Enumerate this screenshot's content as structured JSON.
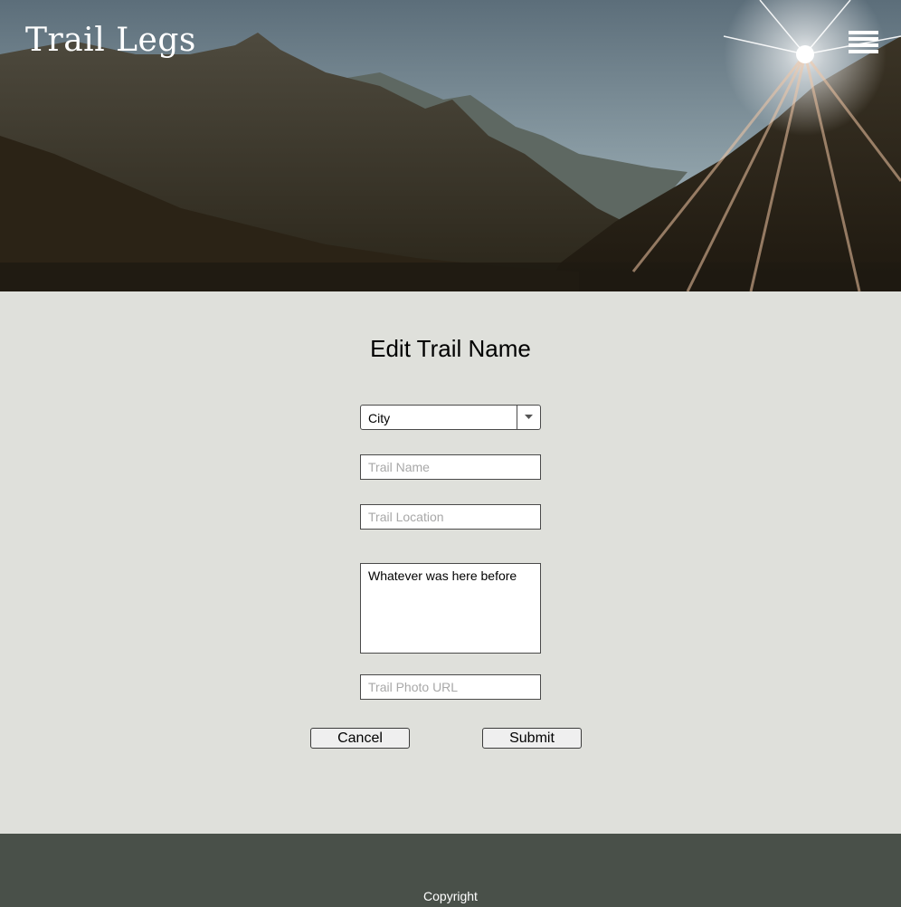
{
  "header": {
    "brand": "Trail Legs",
    "menu_icon": "hamburger-menu-icon"
  },
  "form": {
    "title": "Edit Trail Name",
    "city_select": {
      "selected": "City"
    },
    "trail_name": {
      "placeholder": "Trail Name",
      "value": ""
    },
    "trail_location": {
      "placeholder": "Trail Location",
      "value": ""
    },
    "description": {
      "value": "Whatever was here before"
    },
    "trail_photo_url": {
      "placeholder": "Trail Photo URL",
      "value": ""
    },
    "cancel_label": "Cancel",
    "submit_label": "Submit"
  },
  "footer": {
    "copyright": "Copyright"
  },
  "colors": {
    "page_background": "#dfe0db",
    "footer_background": "#495049",
    "text": "#000000"
  }
}
